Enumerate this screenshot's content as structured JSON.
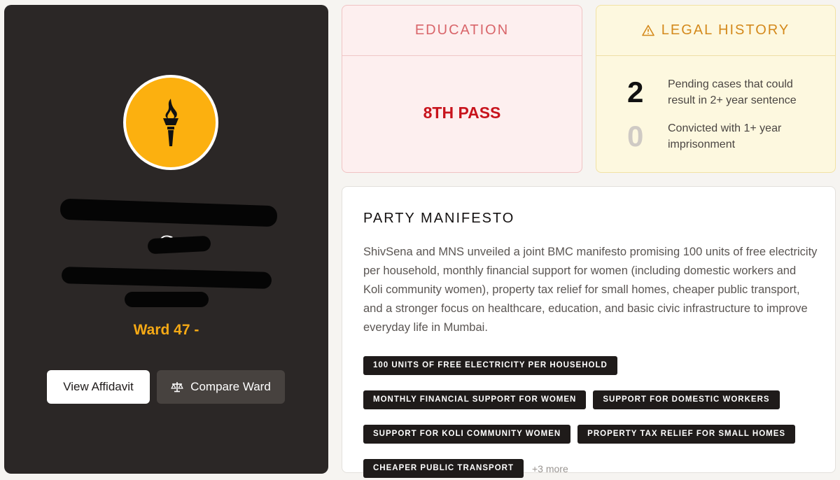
{
  "profile": {
    "name_visible_fragment": "G",
    "ward": "Ward 47 -",
    "view_affidavit_label": "View Affidavit",
    "compare_ward_label": "Compare Ward",
    "avatar_icon": "torch-icon",
    "avatar_color": "#fcb00f"
  },
  "education": {
    "header": "EDUCATION",
    "value": "8TH PASS"
  },
  "legal": {
    "header": "LEGAL HISTORY",
    "header_icon": "warning-icon",
    "pending_count": "2",
    "pending_label": "Pending cases that could result in 2+ year sentence",
    "convicted_count": "0",
    "convicted_label": "Convicted with 1+ year imprisonment"
  },
  "manifesto": {
    "title": "PARTY MANIFESTO",
    "description": "ShivSena and MNS unveiled a joint BMC manifesto promising 100 units of free electricity per household, monthly financial support for women (including domestic workers and Koli community women), property tax relief for small homes, cheaper public transport, and a stronger focus on healthcare, education, and basic civic infrastructure to improve everyday life in Mumbai.",
    "tags": [
      "100 UNITS OF FREE ELECTRICITY PER HOUSEHOLD",
      "MONTHLY FINANCIAL SUPPORT FOR WOMEN",
      "SUPPORT FOR DOMESTIC WORKERS",
      "SUPPORT FOR KOLI COMMUNITY WOMEN",
      "PROPERTY TAX RELIEF FOR SMALL HOMES",
      "CHEAPER PUBLIC TRANSPORT"
    ],
    "more_label": "+3 more"
  },
  "colors": {
    "profile_bg": "#2b2726",
    "ward_accent": "#f5a915",
    "education_accent": "#c8141d",
    "legal_accent": "#d4891b"
  }
}
